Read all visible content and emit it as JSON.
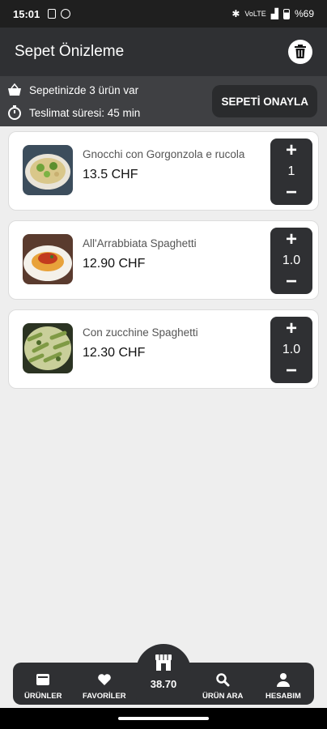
{
  "status_bar": {
    "time": "15:01",
    "battery": "%69"
  },
  "header": {
    "title": "Sepet Önizleme"
  },
  "info": {
    "items_text": "Sepetinizde 3 ürün var",
    "delivery_text": "Teslimat süresi: 45 min",
    "confirm_label": "SEPETİ ONAYLA"
  },
  "cart_items": [
    {
      "name": "Gnocchi con Gorgonzola e rucola",
      "price": "13.5 CHF",
      "quantity": "1"
    },
    {
      "name": "All'Arrabbiata Spaghetti",
      "price": "12.90 CHF",
      "quantity": "1.0"
    },
    {
      "name": "Con zucchine Spaghetti",
      "price": "12.30 CHF",
      "quantity": "1.0"
    }
  ],
  "bottom_nav": {
    "products": "ÜRÜNLER",
    "favorites": "FAVORİLER",
    "cart_total": "38.70",
    "search": "ÜRÜN ARA",
    "account": "HESABIM"
  },
  "colors": {
    "dark": "#2f3033",
    "info_bg": "#3f4043",
    "background": "#eeeeee"
  }
}
